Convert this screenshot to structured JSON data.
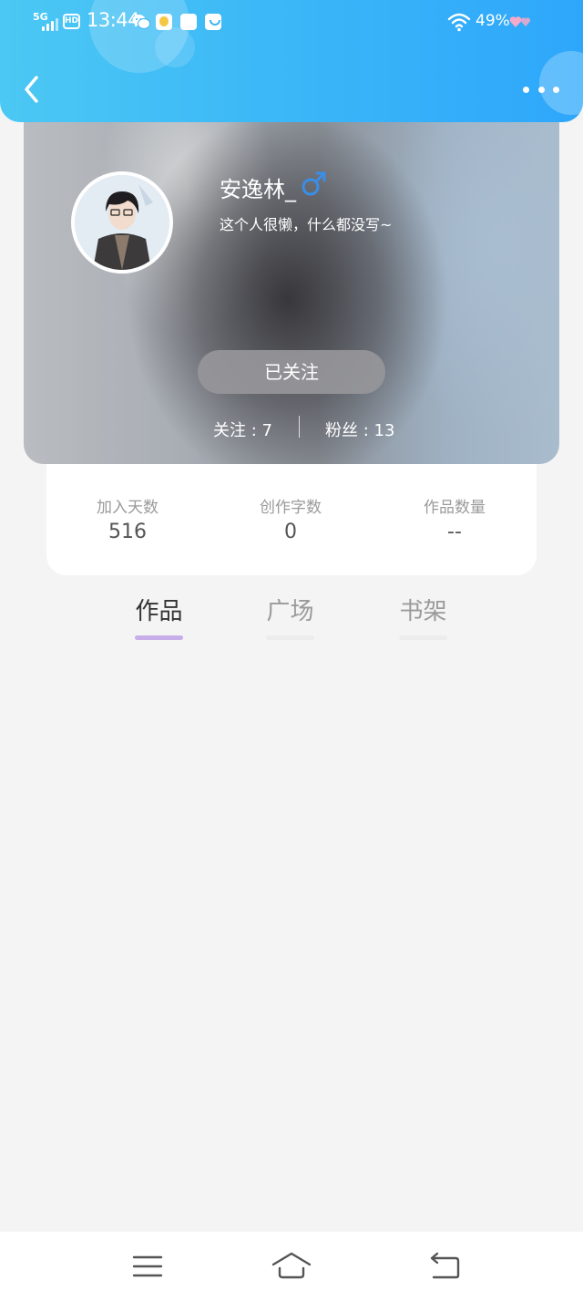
{
  "status_bar": {
    "network": "5G",
    "hd": "HD",
    "time": "13:44",
    "battery": "49%",
    "icons": [
      "signal-icon",
      "hd-icon",
      "wechat-icon",
      "app-icon",
      "app-icon",
      "shopping-bag-icon",
      "wifi-icon",
      "heart-icon"
    ]
  },
  "nav": {
    "back_icon": "chevron-left-icon",
    "more_icon": "more-dots-icon"
  },
  "profile": {
    "username": "安逸林_",
    "gender_icon": "male-icon",
    "bio": "这个人很懒，什么都没写~",
    "follow_button": "已关注",
    "following": "关注 : 7",
    "fans": "粉丝 : 13"
  },
  "stats": [
    {
      "label": "加入天数",
      "value": "516"
    },
    {
      "label": "创作字数",
      "value": "0"
    },
    {
      "label": "作品数量",
      "value": "--"
    }
  ],
  "tabs": [
    {
      "label": "作品",
      "active": true
    },
    {
      "label": "广场",
      "active": false
    },
    {
      "label": "书架",
      "active": false
    }
  ],
  "bottom_nav": {
    "icons": [
      "menu-icon",
      "home-icon",
      "back-icon"
    ]
  },
  "colors": {
    "header_gradient_start": "#4cc8f4",
    "header_gradient_end": "#2ea7fb",
    "tab_active_underline": "#c7aee8",
    "gender_icon": "#3a8ee6"
  }
}
